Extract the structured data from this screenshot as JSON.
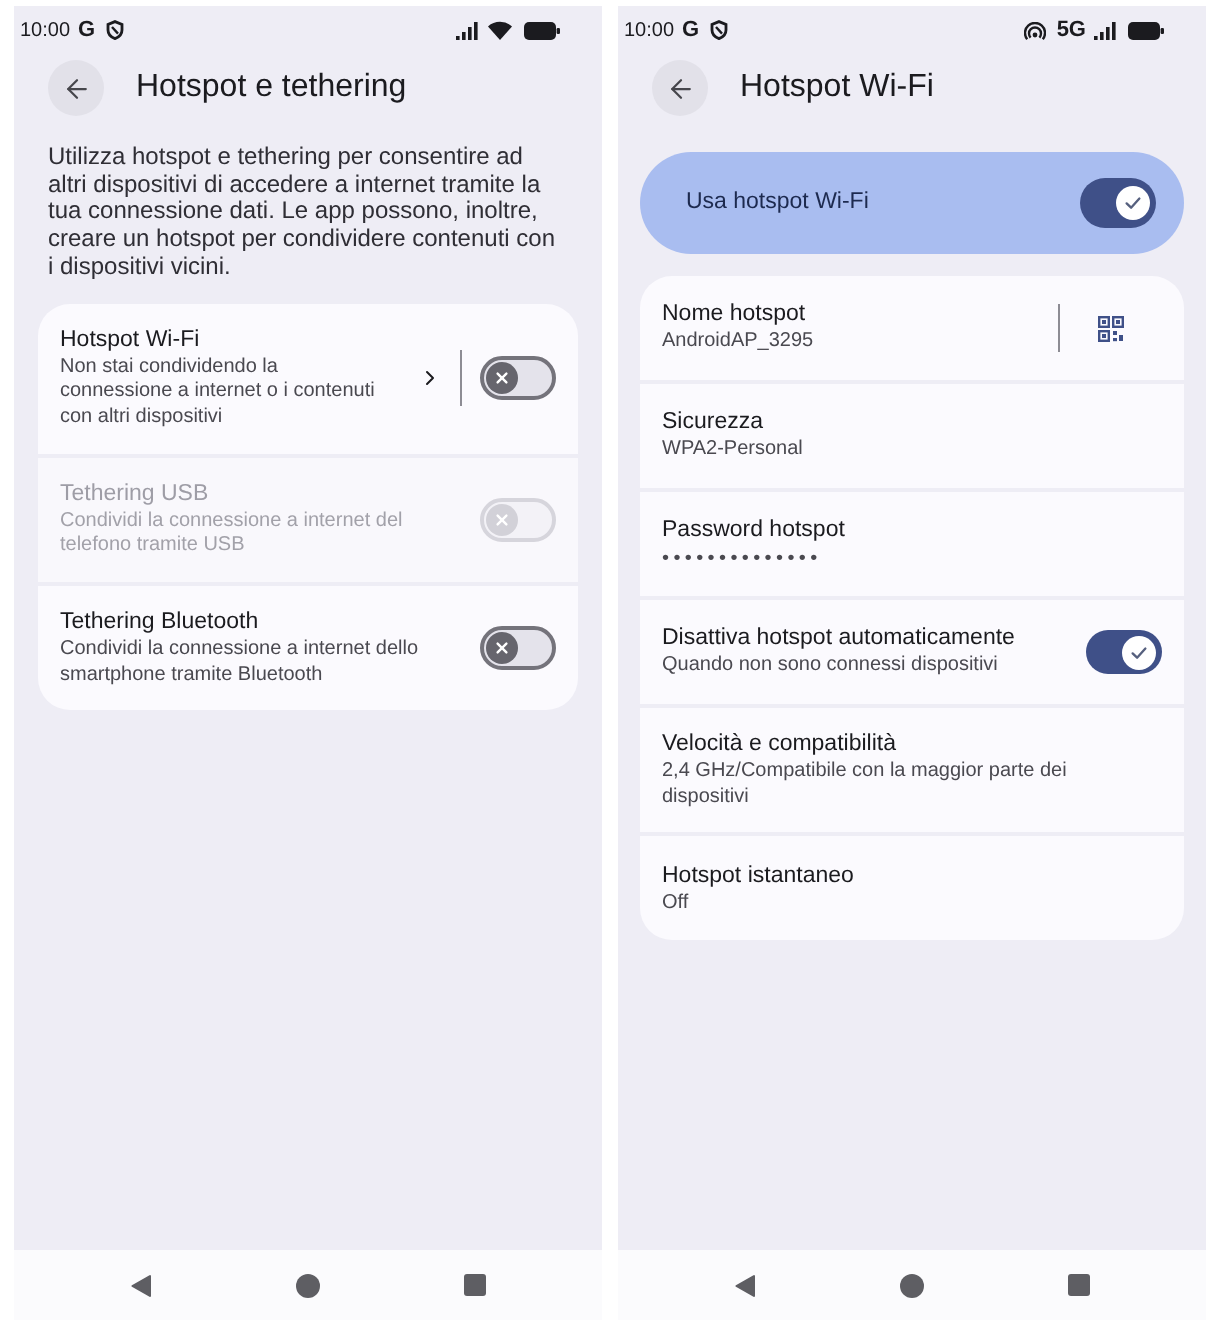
{
  "screens": [
    {
      "status_bar": {
        "time": "10:00",
        "app_letter": "G",
        "wifi": true
      },
      "header": {
        "title": "Hotspot e tethering"
      },
      "description": "Utilizza hotspot e tethering per consentire ad altri dispositivi di accedere a internet tramite la tua connessione dati. Le app possono, inoltre, creare un hotspot per condividere contenuti con i dispositivi vicini.",
      "rows": [
        {
          "kind": "split_toggle",
          "title": "Hotspot Wi-Fi",
          "subtitle": "Non stai condividendo la connessione a internet o i contenuti con altri dispositivi",
          "on": false,
          "disabled": false
        },
        {
          "kind": "toggle",
          "title": "Tethering USB",
          "subtitle": "Condividi la connessione a internet del telefono tramite USB",
          "on": false,
          "disabled": true
        },
        {
          "kind": "toggle",
          "title": "Tethering Bluetooth",
          "subtitle": "Condividi la connessione a internet dello smartphone tramite Bluetooth",
          "on": false,
          "disabled": false
        }
      ]
    },
    {
      "status_bar": {
        "time": "10:00",
        "app_letter": "G",
        "hotspot": true,
        "network": "5G"
      },
      "header": {
        "title": "Hotspot Wi-Fi"
      },
      "main_switch": {
        "label": "Usa hotspot Wi-Fi",
        "on": true
      },
      "rows": [
        {
          "kind": "qr_text",
          "title": "Nome hotspot",
          "subtitle": "AndroidAP_3295",
          "disabled": false
        },
        {
          "kind": "text",
          "title": "Sicurezza",
          "subtitle": "WPA2-Personal",
          "disabled": false
        },
        {
          "kind": "password",
          "title": "Password hotspot",
          "subtitle": "••••••••••••••",
          "disabled": false
        },
        {
          "kind": "toggle",
          "title": "Disattiva hotspot automaticamente",
          "subtitle": "Quando non sono connessi dispositivi",
          "on": true,
          "disabled": false
        },
        {
          "kind": "text",
          "title": "Velocità e compatibilità",
          "subtitle": "2,4 GHz/Compatibile con la maggior parte dei dispositivi",
          "disabled": false
        },
        {
          "kind": "text",
          "title": "Hotspot istantaneo",
          "subtitle": "Off",
          "disabled": false
        }
      ]
    }
  ]
}
